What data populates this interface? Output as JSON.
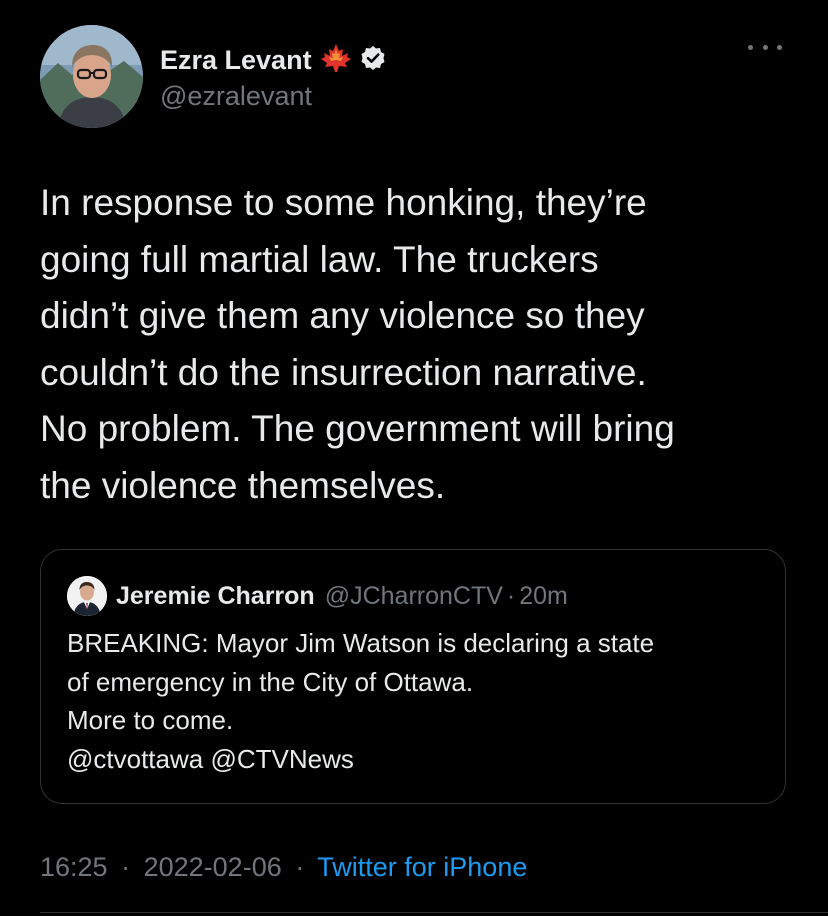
{
  "author": {
    "display_name": "Ezra Levant",
    "handle": "@ezralevant",
    "flag_icon": "maple-leaf-icon",
    "verified_icon": "verified-badge-icon"
  },
  "tweet": {
    "text": "In response to some honking, they’re\ngoing full martial law. The truckers\ndidn’t give them any violence so they\ncouldn’t do the insurrection narrative.\nNo problem. The government will bring\nthe violence themselves."
  },
  "quoted_tweet": {
    "display_name": "Jeremie Charron",
    "handle": "@JCharronCTV",
    "separator": "·",
    "time": "20m",
    "text": "BREAKING: Mayor Jim Watson is declaring a state\nof emergency in the City of Ottawa.\nMore to come.\n@ctvottawa @CTVNews"
  },
  "footer": {
    "time": "16:25",
    "separator": "·",
    "date": "2022-02-06",
    "source": "Twitter for iPhone"
  },
  "colors": {
    "background": "#000000",
    "text_primary": "#e7e9ea",
    "text_secondary": "#71767b",
    "link": "#1d9bf0",
    "border": "#2f3336",
    "maple_leaf": "#e0332b"
  }
}
